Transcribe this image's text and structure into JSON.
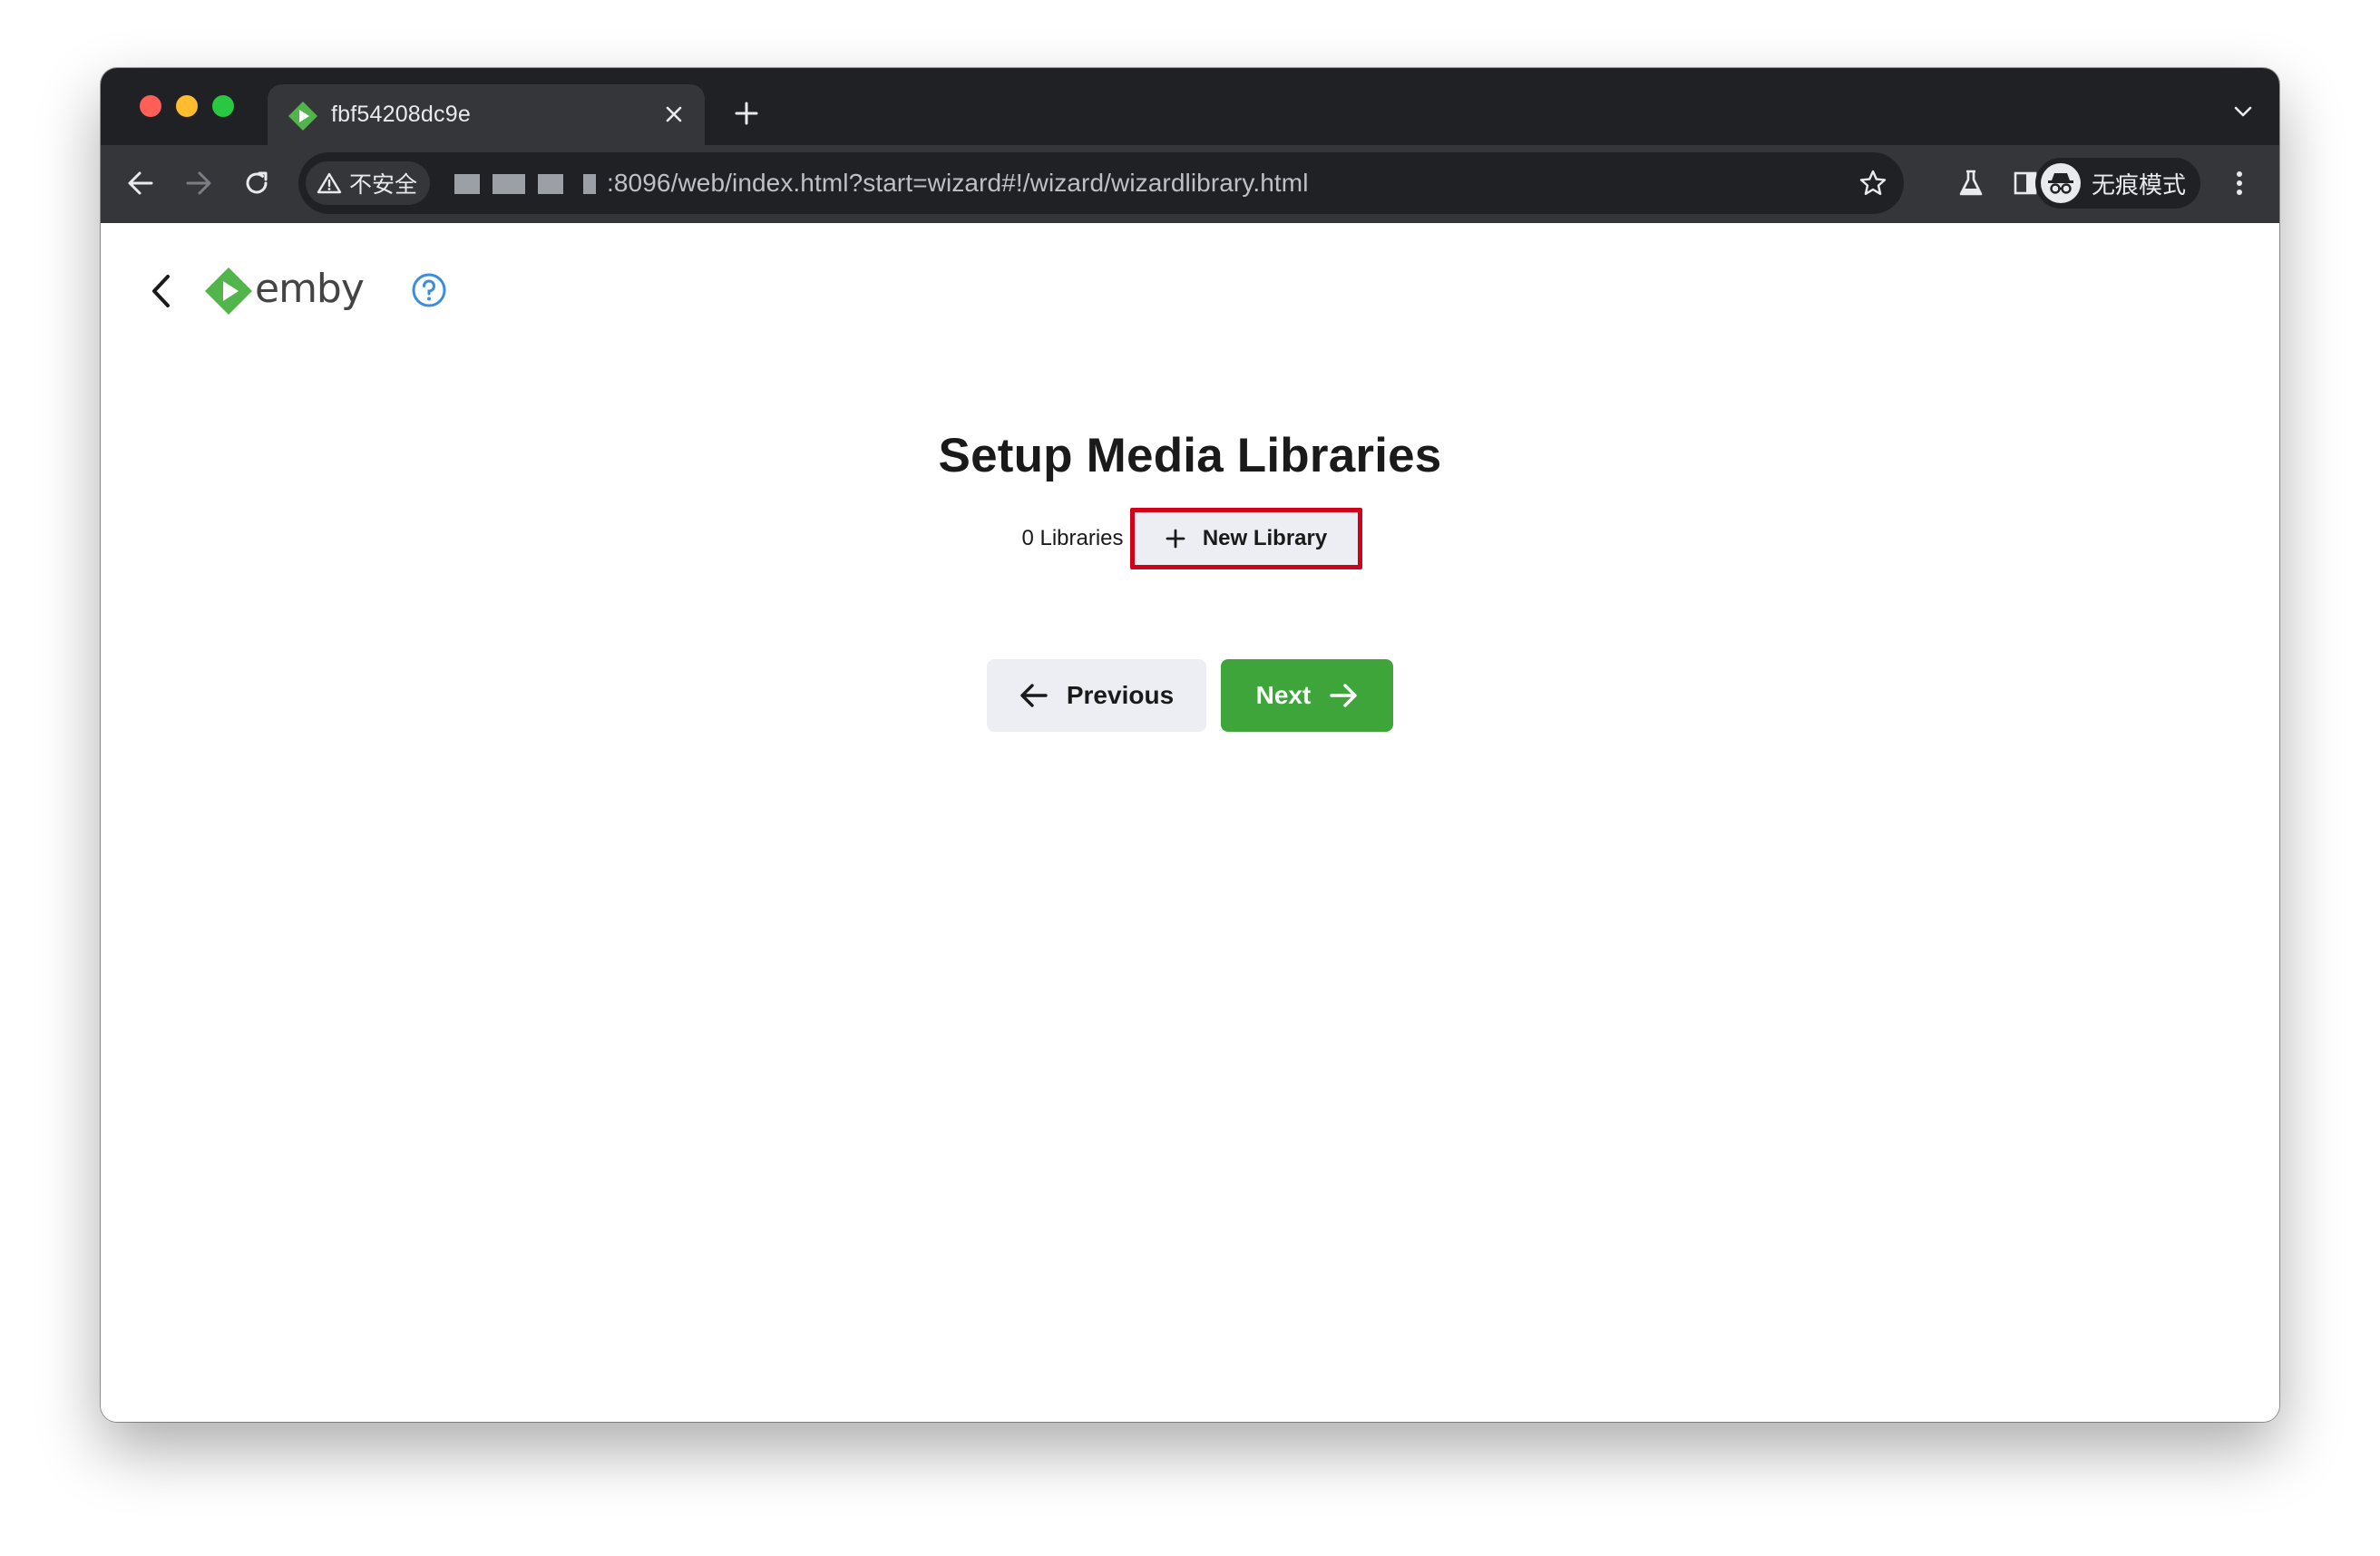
{
  "browser": {
    "tab_title": "fbf54208dc9e",
    "security_label": "不安全",
    "url_text": ":8096/web/index.html?start=wizard#!/wizard/wizardlibrary.html",
    "incognito_label": "无痕模式"
  },
  "app": {
    "logo_text": "emby",
    "page_title": "Setup Media Libraries",
    "library_count": "0 Libraries",
    "new_library_label": "New Library",
    "previous_label": "Previous",
    "next_label": "Next"
  },
  "colors": {
    "accent_green": "#3ea53a",
    "highlight_red": "#d0021b",
    "help_blue": "#3b8ede"
  }
}
